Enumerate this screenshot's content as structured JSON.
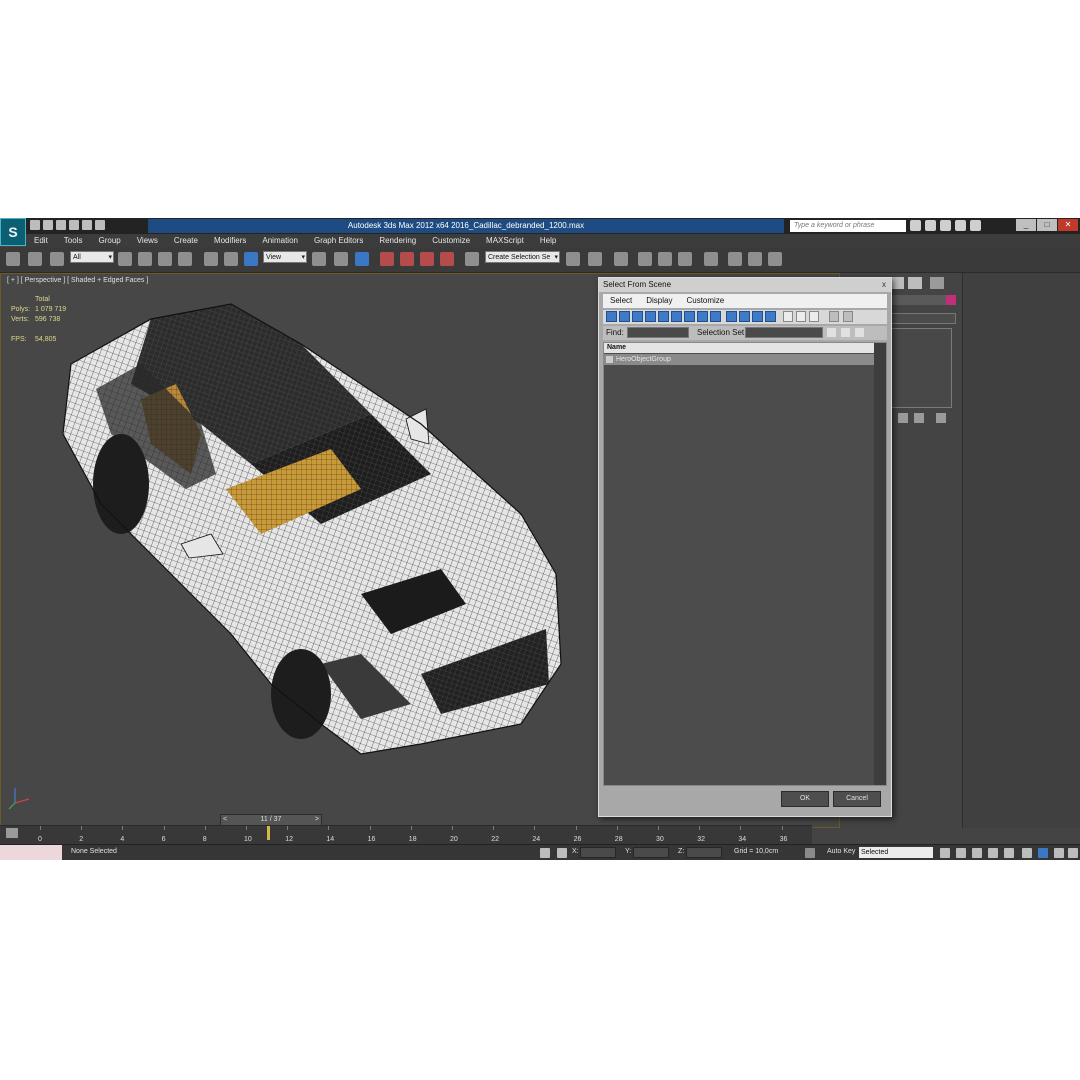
{
  "titlebar": {
    "app_title": "Autodesk 3ds Max  2012 x64     2016_Cadillac_debranded_1200.max",
    "search_placeholder": "Type a keyword or phrase",
    "logo_glyph": "S"
  },
  "menu": [
    "Edit",
    "Tools",
    "Group",
    "Views",
    "Create",
    "Modifiers",
    "Animation",
    "Graph Editors",
    "Rendering",
    "Customize",
    "MAXScript",
    "Help"
  ],
  "toolbar": {
    "selection_filter": "All",
    "ref_coord": "View",
    "named_selection": "Create Selection Se",
    "snap_3": "3",
    "snap_percent": "%"
  },
  "viewport": {
    "label": "[ + ] [ Perspective ] [ Shaded + Edged Faces ]",
    "stats": {
      "total_label": "Total",
      "polys_label": "Polys:",
      "polys_value": "1 079 719",
      "verts_label": "Verts:",
      "verts_value": "596 738",
      "fps_label": "FPS:",
      "fps_value": "54,805"
    }
  },
  "dialog": {
    "title": "Select From Scene",
    "close_glyph": "x",
    "menu": [
      "Select",
      "Display",
      "Customize"
    ],
    "find_label": "Find:",
    "selection_set_label": "Selection Set:",
    "column_name": "Name",
    "items": [
      "HeroObjectGroup"
    ],
    "ok_label": "OK",
    "cancel_label": "Cancel"
  },
  "timeline": {
    "frame_counter": "11 / 37",
    "prev_glyph": "<",
    "next_glyph": ">",
    "ticks": [
      "0",
      "2",
      "4",
      "6",
      "8",
      "10",
      "12",
      "14",
      "16",
      "18",
      "20",
      "22",
      "24",
      "26",
      "28",
      "30",
      "32",
      "34",
      "36"
    ],
    "current_frame": 11,
    "total_frames": 37
  },
  "status": {
    "selection_text": "None Selected",
    "x_label": "X:",
    "y_label": "Y:",
    "z_label": "Z:",
    "grid_text": "Grid = 10,0cm",
    "auto_key_label": "Auto Key",
    "selected_dropdown": "Selected"
  },
  "colors": {
    "title_strip": "#1e4c82",
    "viewport_bg": "#474747",
    "stats_text": "#e1d98b",
    "car_body": "#e6e6e6",
    "car_interior": "#c99a3a"
  }
}
